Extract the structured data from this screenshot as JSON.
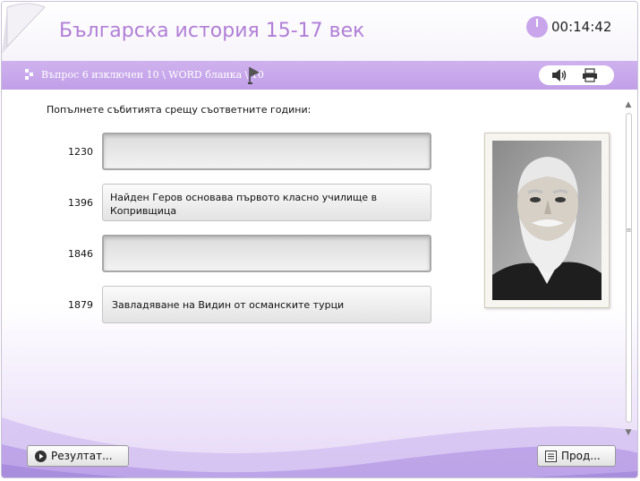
{
  "header": {
    "title": "Българска история 15-17 век",
    "timer": "00:14:42"
  },
  "question_bar": {
    "text": "Въпрос 6 изключен 10 \\ WORD бланка \\ 10"
  },
  "main": {
    "instructions": "Попълнете събитията срещу съответните години:",
    "rows": [
      {
        "year": "1230",
        "answer": ""
      },
      {
        "year": "1396",
        "answer": "Найден Геров основава първото класно училище в Копривщица"
      },
      {
        "year": "1846",
        "answer": ""
      },
      {
        "year": "1879",
        "answer": "Завладяване на Видин от османските турци"
      }
    ]
  },
  "footer": {
    "result_label": "Резултат...",
    "next_label": "Прод..."
  },
  "colors": {
    "accent": "#c19fe8",
    "title": "#b07fd6"
  },
  "icons": [
    "timer-icon",
    "flag-icon",
    "speaker-icon",
    "print-icon",
    "play-icon",
    "list-icon"
  ]
}
